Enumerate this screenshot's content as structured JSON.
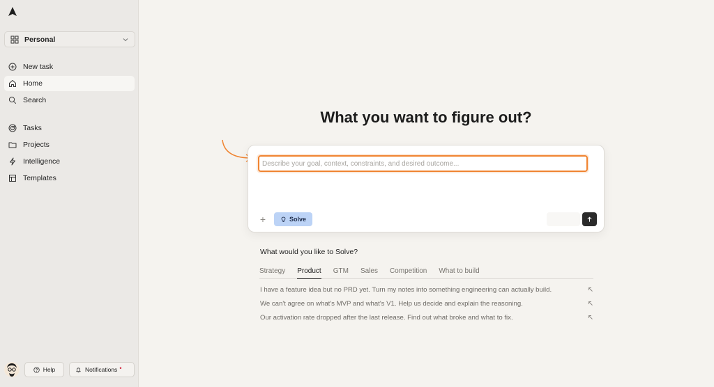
{
  "sidebar": {
    "workspace": {
      "label": "Personal"
    },
    "items": [
      {
        "label": "New task",
        "icon": "plus-circle-icon"
      },
      {
        "label": "Home",
        "icon": "home-icon",
        "active": true
      },
      {
        "label": "Search",
        "icon": "search-icon"
      },
      {
        "label": "Tasks",
        "icon": "target-icon"
      },
      {
        "label": "Projects",
        "icon": "folder-icon"
      },
      {
        "label": "Intelligence",
        "icon": "bolt-icon"
      },
      {
        "label": "Templates",
        "icon": "layout-icon"
      }
    ],
    "help_label": "Help",
    "notifications_label": "Notifications",
    "notifications_dot": "•"
  },
  "main": {
    "headline": "What you want to figure out?",
    "composer": {
      "placeholder": "Describe your goal, context, constraints, and desired outcome...",
      "value": "",
      "solve_label": "Solve"
    },
    "suggestions_title": "What would you like to Solve?",
    "tabs": [
      {
        "label": "Strategy"
      },
      {
        "label": "Product",
        "active": true
      },
      {
        "label": "GTM"
      },
      {
        "label": "Sales"
      },
      {
        "label": "Competition"
      },
      {
        "label": "What to build"
      }
    ],
    "suggestions": [
      "I have a feature idea but no PRD yet. Turn my notes into something engineering can actually build.",
      "We can't agree on what's MVP and what's V1. Help us decide and explain the reasoning.",
      "Our activation rate dropped after the last release. Find out what broke and what to fix."
    ]
  },
  "colors": {
    "accent_orange": "#f08431",
    "solve_blue": "#bcd3f6",
    "notification_red": "#d0213a"
  }
}
